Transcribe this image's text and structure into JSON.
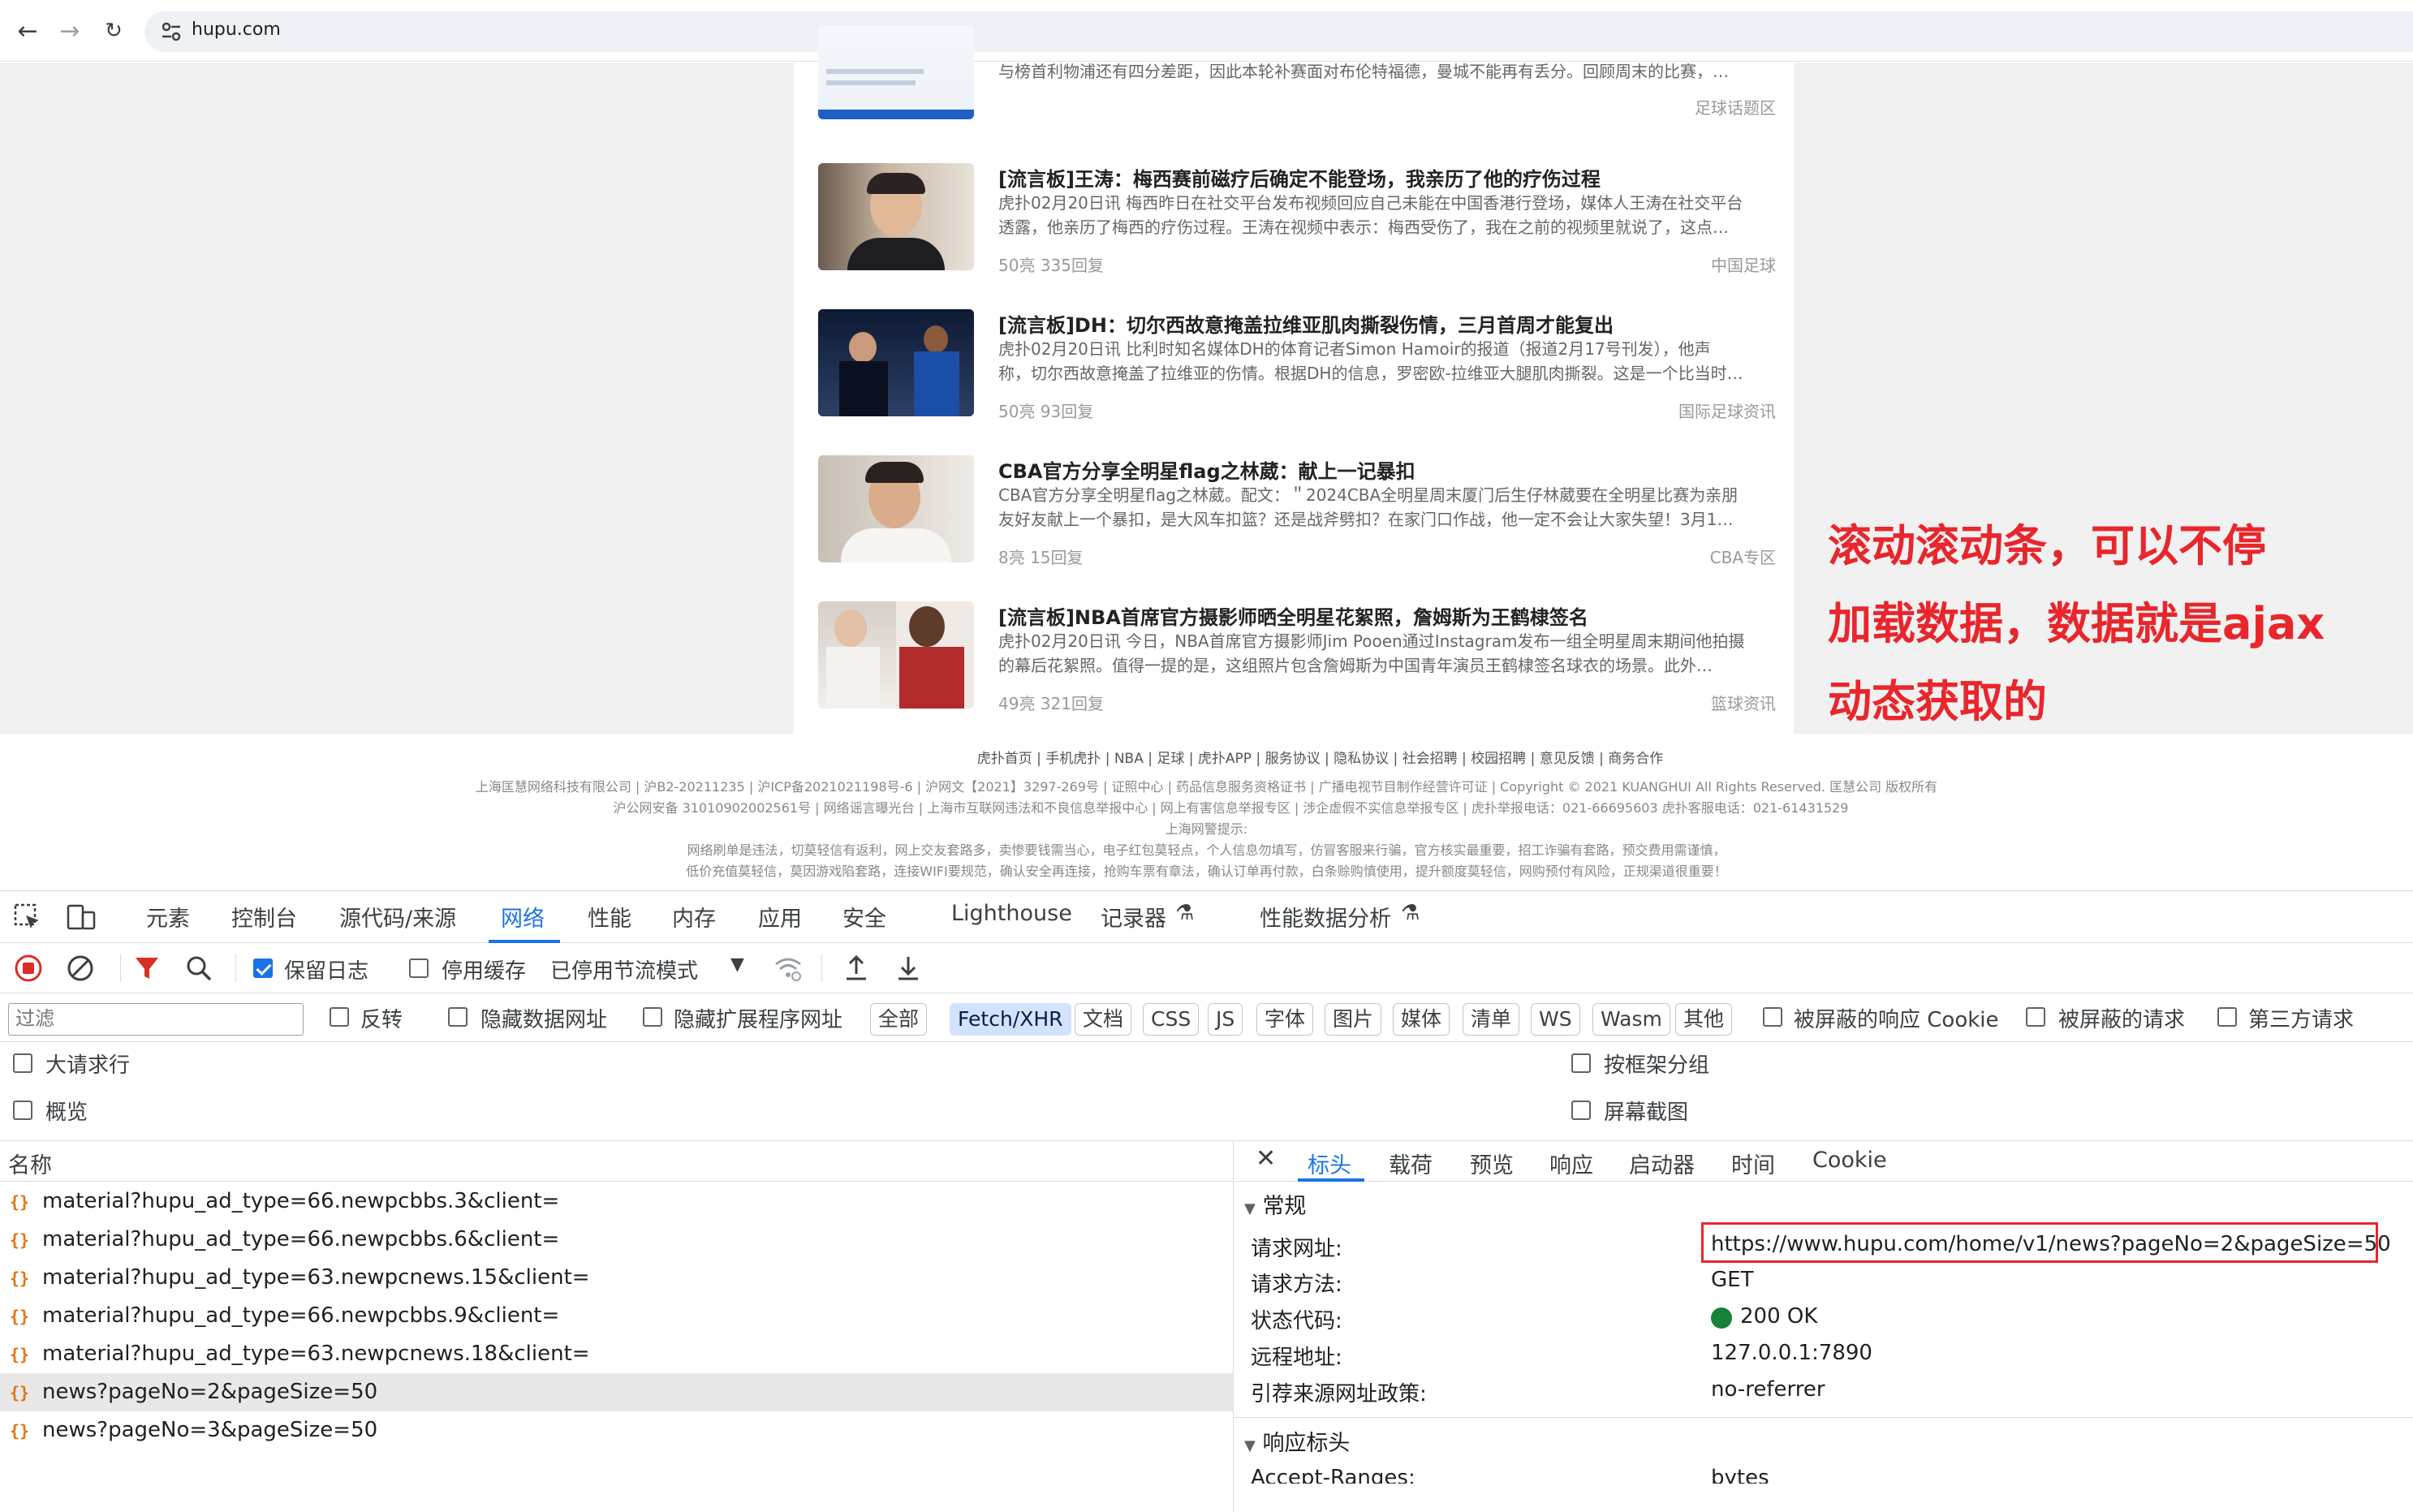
{
  "browser": {
    "url": "hupu.com"
  },
  "news": [
    {
      "desc2": "与榜首利物浦还有四分差距，因此本轮补赛面对布伦特福德，曼城不能再有丢分。回顾周末的比赛，…",
      "category": "足球话题区"
    },
    {
      "title": "[流言板]王涛：梅西赛前磁疗后确定不能登场，我亲历了他的疗伤过程",
      "desc1": "虎扑02月20日讯 梅西昨日在社交平台发布视频回应自己未能在中国香港行登场，媒体人王涛在社交平台",
      "desc2": "透露，他亲历了梅西的疗伤过程。王涛在视频中表示：梅西受伤了，我在之前的视频里就说了，这点…",
      "meta": "50亮 335回复",
      "category": "中国足球"
    },
    {
      "title": "[流言板]DH：切尔西故意掩盖拉维亚肌肉撕裂伤情，三月首周才能复出",
      "desc1": "虎扑02月20日讯 比利时知名媒体DH的体育记者Simon Hamoir的报道（报道2月17号刊发），他声",
      "desc2": "称，切尔西故意掩盖了拉维亚的伤情。根据DH的信息，罗密欧-拉维亚大腿肌肉撕裂。这是一个比当时…",
      "meta": "50亮 93回复",
      "category": "国际足球资讯"
    },
    {
      "title": "CBA官方分享全明星flag之林葳：献上一记暴扣",
      "desc1": "CBA官方分享全明星flag之林葳。配文：＂2024CBA全明星周末厦门后生仔林葳要在全明星比赛为亲朋",
      "desc2": "友好友献上一个暴扣，是大风车扣篮？还是战斧劈扣？在家门口作战，他一定不会让大家失望！3月1…",
      "meta": "8亮 15回复",
      "category": "CBA专区"
    },
    {
      "title": "[流言板]NBA首席官方摄影师晒全明星花絮照，詹姆斯为王鹤棣签名",
      "desc1": "虎扑02月20日讯 今日，NBA首席官方摄影师Jim Pooen通过Instagram发布一组全明星周末期间他拍摄",
      "desc2": "的幕后花絮照。值得一提的是，这组照片包含詹姆斯为中国青年演员王鹤棣签名球衣的场景。此外…",
      "meta": "49亮 321回复",
      "category": "篮球资讯"
    }
  ],
  "annotation": {
    "line1": "滚动滚动条，可以不停",
    "line2": "加载数据，数据就是ajax",
    "line3": "动态获取的"
  },
  "footer": {
    "links": "虎扑首页 | 手机虎扑 | NBA | 足球 | 虎扑APP | 服务协议 | 隐私协议 | 社会招聘 | 校园招聘 | 意见反馈 | 商务合作",
    "line2": "上海匡慧网络科技有限公司 | 沪B2-20211235 | 沪ICP备2021021198号-6 | 沪网文【2021】3297-269号 | 证照中心 | 药品信息服务资格证书 | 广播电视节目制作经营许可证 | Copyright © 2021 KUANGHUI All Rights Reserved. 匡慧公司 版权所有",
    "line3": "沪公网安备 31010902002561号 | 网络谣言曝光台 | 上海市互联网违法和不良信息举报中心 | 网上有害信息举报专区 | 涉企虚假不实信息举报专区 | 虎扑举报电话：021-66695603 虎扑客服电话：021-61431529",
    "line4": "上海网警提示:",
    "line5": "网络刷单是违法，切莫轻信有返利，网上交友套路多，卖惨要钱需当心，电子红包莫轻点，个人信息勿填写，仿冒客服来行骗，官方核实最重要，招工诈骗有套路，预交费用需谨慎，",
    "line6": "低价充值莫轻信，莫因游戏陷套路，连接WIFI要规范，确认安全再连接，抢购车票有章法，确认订单再付款，白条赊购慎使用，提升额度莫轻信，网购预付有风险，正规渠道很重要！"
  },
  "devtools": {
    "tabs": [
      "元素",
      "控制台",
      "源代码/来源",
      "网络",
      "性能",
      "内存",
      "应用",
      "安全",
      "Lighthouse",
      "记录器",
      "性能数据分析"
    ],
    "active_tab": "网络",
    "toolbar": {
      "preserve_log": "保留日志",
      "disable_cache": "停用缓存",
      "throttle": "已停用节流模式"
    },
    "filter": {
      "placeholder": "过滤",
      "invert": "反转",
      "hide_data_urls": "隐藏数据网址",
      "hide_ext_urls": "隐藏扩展程序网址",
      "types": [
        "全部",
        "Fetch/XHR",
        "文档",
        "CSS",
        "JS",
        "字体",
        "图片",
        "媒体",
        "清单",
        "WS",
        "Wasm",
        "其他"
      ],
      "active_type": "Fetch/XHR",
      "blocked_cookies": "被屏蔽的响应 Cookie",
      "blocked_requests": "被屏蔽的请求",
      "third_party": "第三方请求"
    },
    "options": {
      "big_rows": "大请求行",
      "overview": "概览",
      "group_by_frame": "按框架分组",
      "screenshots": "屏幕截图"
    },
    "list_header": "名称",
    "requests": [
      "material?hupu_ad_type=66.newpcbbs.3&client=",
      "material?hupu_ad_type=66.newpcbbs.6&client=",
      "material?hupu_ad_type=63.newpcnews.15&client=",
      "material?hupu_ad_type=66.newpcbbs.9&client=",
      "material?hupu_ad_type=63.newpcnews.18&client=",
      "news?pageNo=2&pageSize=50",
      "news?pageNo=3&pageSize=50"
    ],
    "selected_request": "news?pageNo=2&pageSize=50",
    "detail_tabs": [
      "标头",
      "载荷",
      "预览",
      "响应",
      "启动器",
      "时间",
      "Cookie"
    ],
    "detail_active": "标头",
    "general": {
      "title": "常规",
      "request_url_key": "请求网址:",
      "request_url": "https://www.hupu.com/home/v1/news?pageNo=2&pageSize=50",
      "method_key": "请求方法:",
      "method": "GET",
      "status_key": "状态代码:",
      "status": "200 OK",
      "remote_key": "远程地址:",
      "remote": "127.0.0.1:7890",
      "referrer_key": "引荐来源网址政策:",
      "referrer": "no-referrer"
    },
    "response_headers": {
      "title": "响应标头",
      "first_key": "Accept-Ranges:",
      "first_val": "bytes"
    },
    "colors": {
      "accent": "#1a73e8",
      "status_ok": "#188038",
      "highlight_box": "#e8262c",
      "record_stop": "#d93025",
      "xhr_icon": "#e8710a"
    }
  }
}
